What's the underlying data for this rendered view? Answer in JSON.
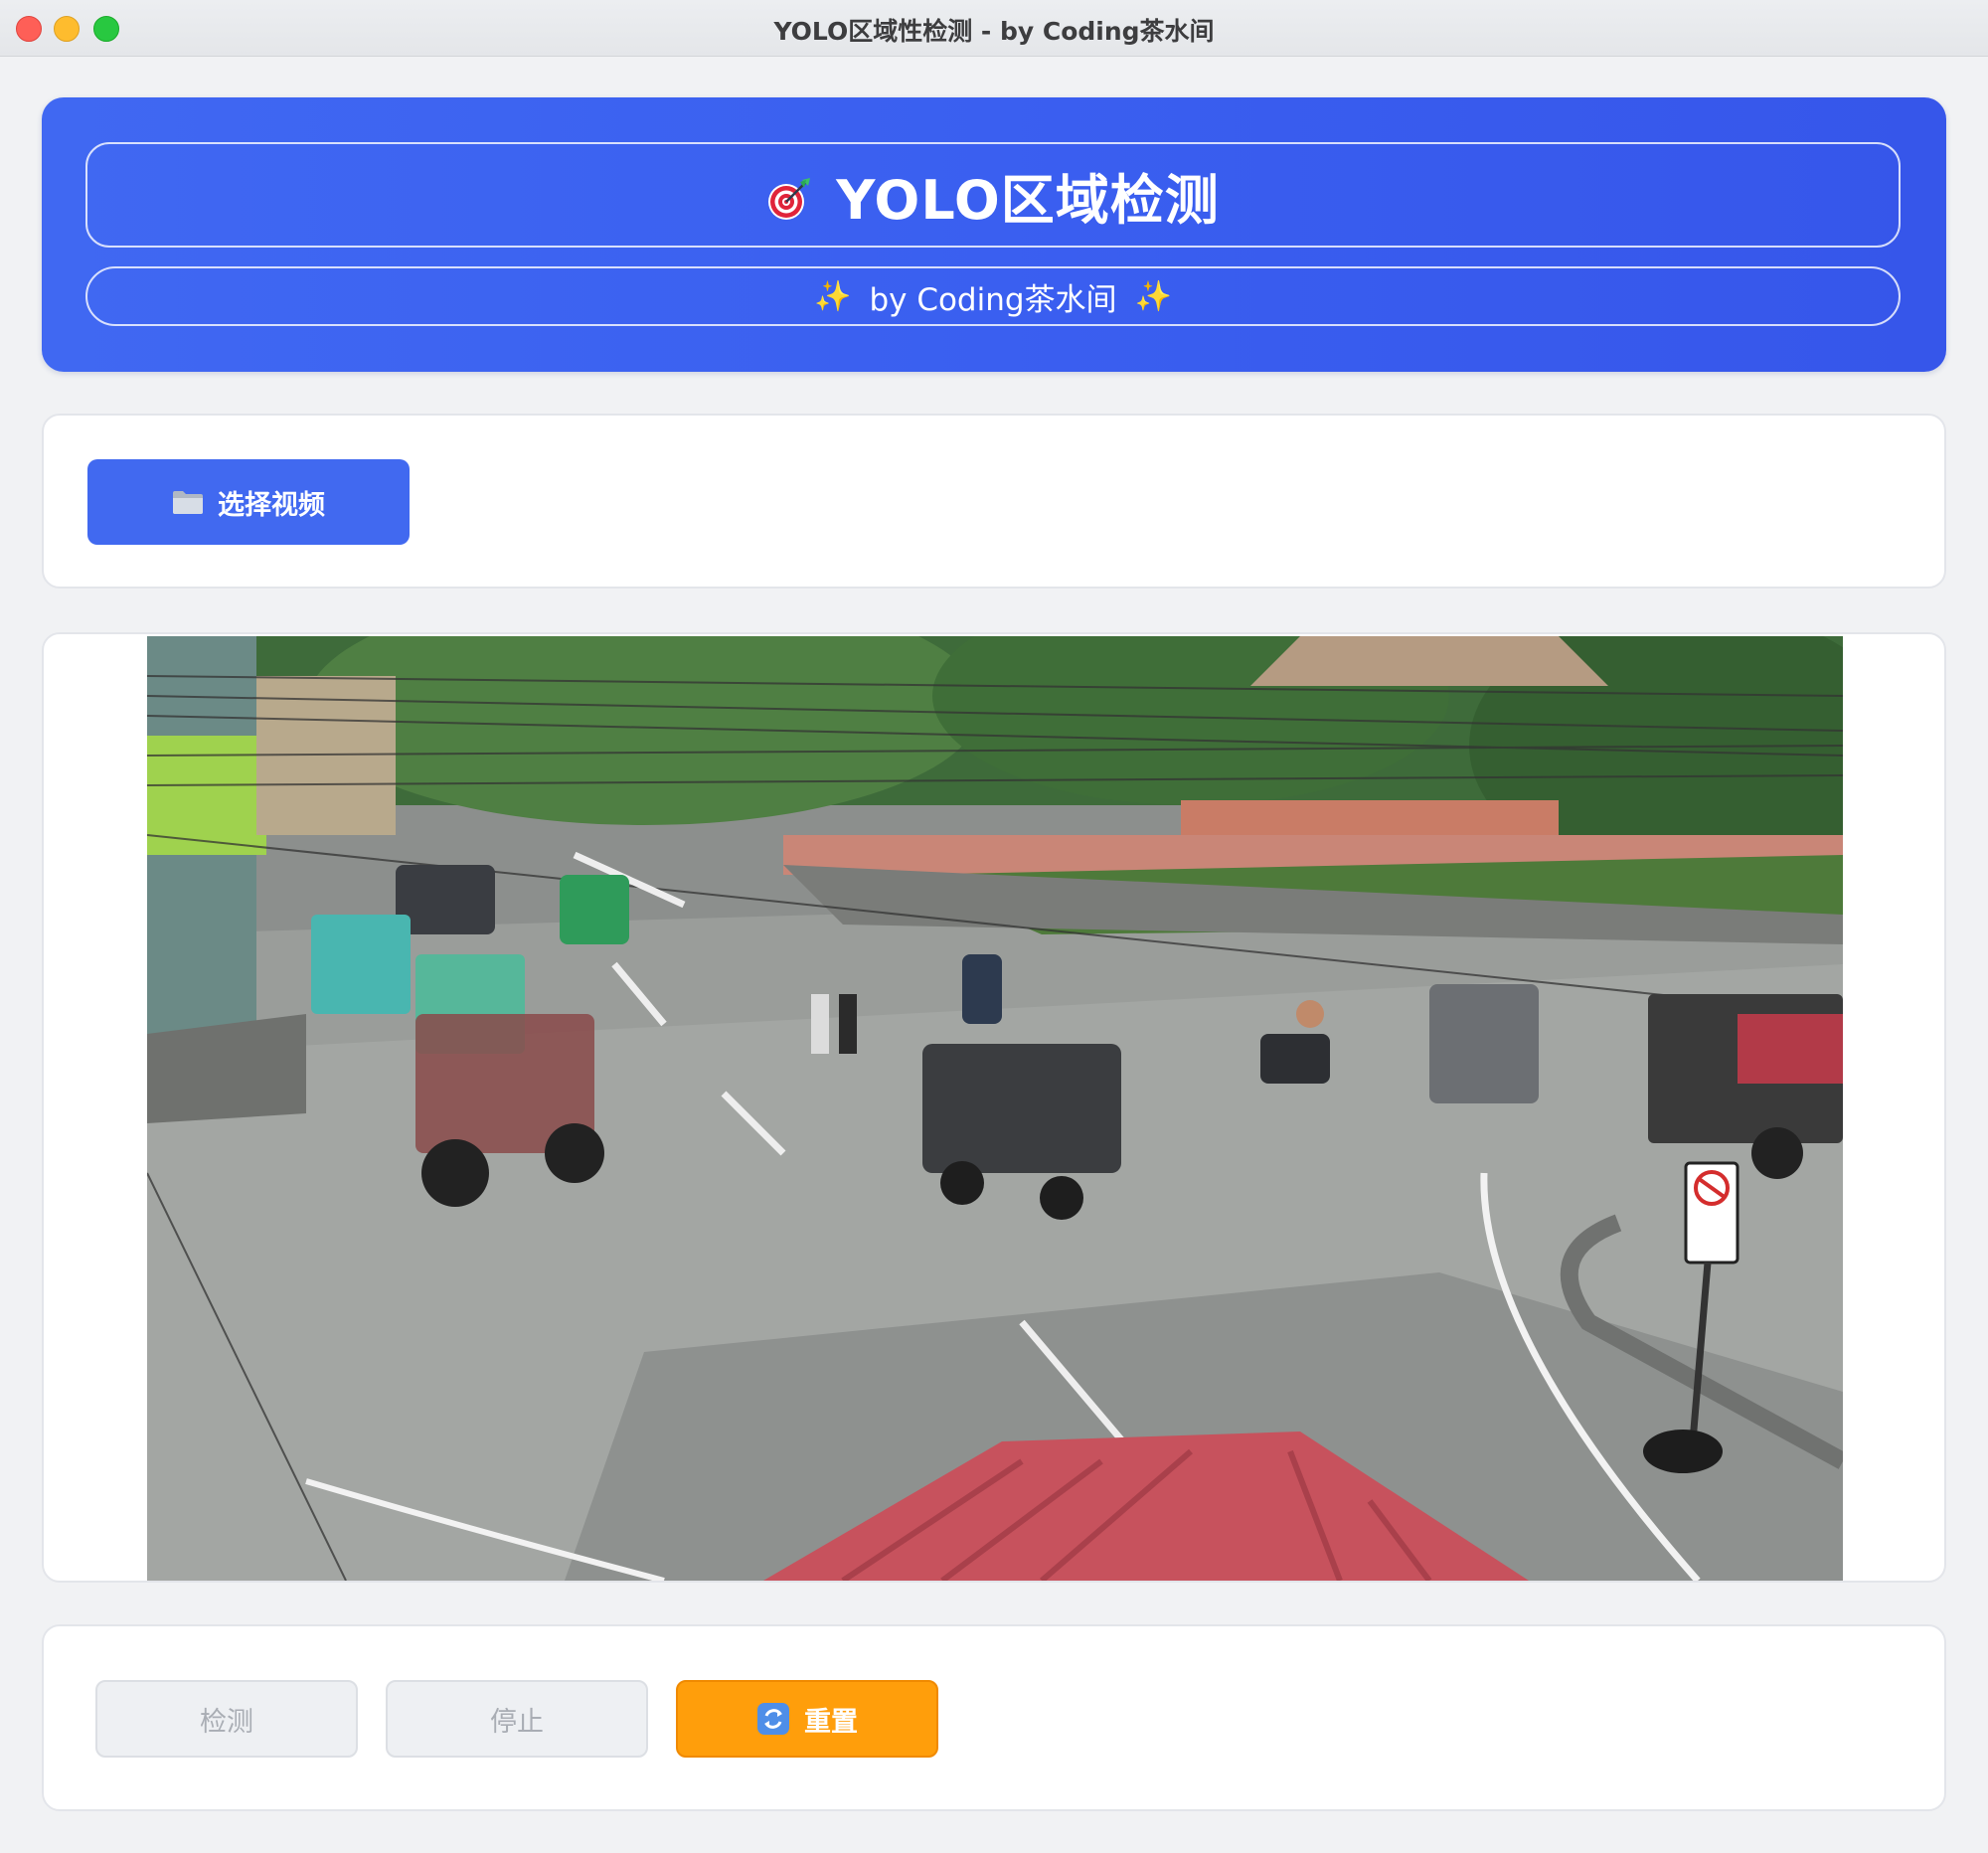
{
  "window": {
    "title": "YOLO区域性检测 - by Coding茶水间"
  },
  "header": {
    "title": "YOLO区域检测",
    "title_icon": "target-icon",
    "subtitle": "by Coding茶水间",
    "subtitle_left_decoration": "✨",
    "subtitle_right_decoration": "✨",
    "gradient_start": "#4068f2",
    "gradient_end": "#3656ea"
  },
  "file_panel": {
    "select_video_label": "选择视频",
    "select_video_icon": "folder-icon",
    "button_color": "#4169f0"
  },
  "video_panel": {
    "frame_description_icon": "video-frame"
  },
  "controls": {
    "detect_label": "检测",
    "detect_enabled": false,
    "stop_label": "停止",
    "stop_enabled": false,
    "reset_label": "重置",
    "reset_icon": "refresh-icon",
    "reset_enabled": true,
    "reset_color": "#ff9e0b"
  }
}
